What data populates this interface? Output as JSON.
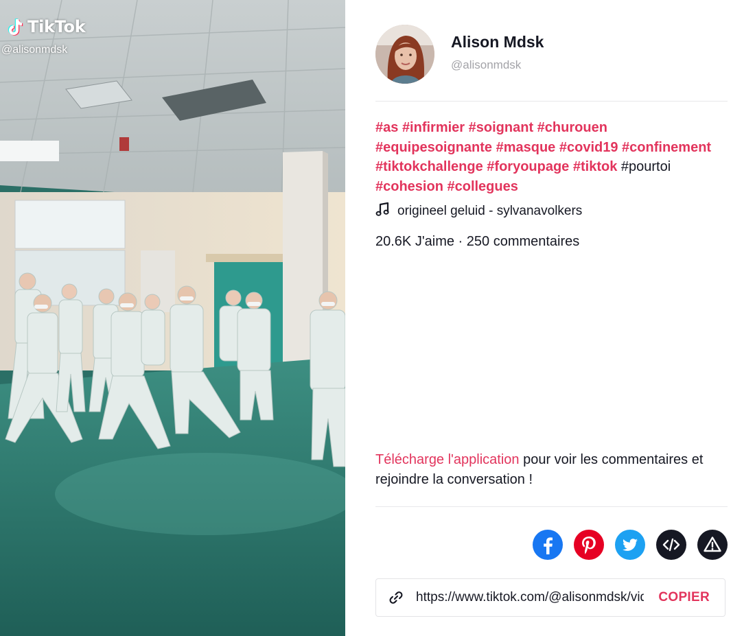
{
  "video": {
    "brand": "TikTok",
    "handle": "@alisonmdsk"
  },
  "author": {
    "display_name": "Alison Mdsk",
    "handle": "@alisonmdsk"
  },
  "caption": [
    {
      "text": "#as",
      "tag": true
    },
    {
      "text": "#infirmier",
      "tag": true
    },
    {
      "text": "#soignant",
      "tag": true
    },
    {
      "text": "#churouen",
      "tag": true
    },
    {
      "text": "#equipesoignante",
      "tag": true
    },
    {
      "text": "#masque",
      "tag": true
    },
    {
      "text": "#covid19",
      "tag": true
    },
    {
      "text": "#confinement",
      "tag": true
    },
    {
      "text": "#tiktokchallenge",
      "tag": true
    },
    {
      "text": "#foryoupage",
      "tag": true
    },
    {
      "text": "#tiktok",
      "tag": true
    },
    {
      "text": "#pourtoi",
      "tag": false
    },
    {
      "text": "#cohesion",
      "tag": true
    },
    {
      "text": "#collegues",
      "tag": true
    }
  ],
  "music": {
    "icon": "music-note-icon",
    "label": "origineel geluid - sylvanavolkers"
  },
  "stats": {
    "text": "20.6K J'aime · 250 commentaires"
  },
  "cta": {
    "link_text": "Télécharge l'application",
    "rest_text": " pour voir les commentaires et rejoindre la conversation !"
  },
  "share": [
    {
      "name": "facebook-share-button",
      "icon": "facebook-icon",
      "color": "#1877f2"
    },
    {
      "name": "pinterest-share-button",
      "icon": "pinterest-icon",
      "color": "#e60023"
    },
    {
      "name": "twitter-share-button",
      "icon": "twitter-icon",
      "color": "#1da1f2"
    },
    {
      "name": "embed-button",
      "icon": "code-icon",
      "color": "#161823"
    },
    {
      "name": "report-button",
      "icon": "warning-icon",
      "color": "#161823"
    }
  ],
  "link": {
    "url": "https://www.tiktok.com/@alisonmdsk/video/",
    "copy_label": "COPIER"
  },
  "colors": {
    "accent": "#e2345c",
    "text": "#161823",
    "muted": "#a3a3a8"
  }
}
